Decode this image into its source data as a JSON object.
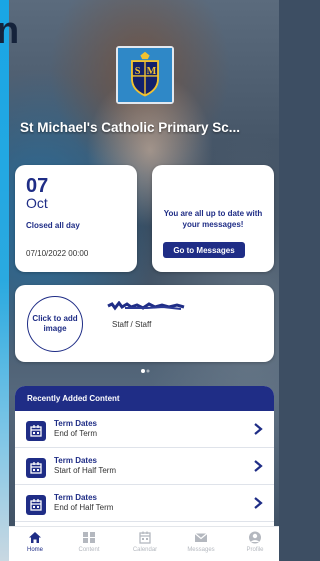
{
  "top_fragment": "n",
  "school": {
    "name": "St Michael's Catholic Primary Sc..."
  },
  "date_card": {
    "day": "07",
    "month": "Oct",
    "status": "Closed all day",
    "datetime": "07/10/2022 00:00"
  },
  "messages_card": {
    "text": "You are all up to date with your messages!",
    "button_label": "Go to Messages"
  },
  "profile": {
    "avatar_label": "Click to add image",
    "role": "Staff / Staff"
  },
  "content": {
    "header": "Recently Added Content",
    "items": [
      {
        "title": "Term Dates",
        "subtitle": "End of Term"
      },
      {
        "title": "Term Dates",
        "subtitle": "Start of Half Term"
      },
      {
        "title": "Term Dates",
        "subtitle": "End of Half Term"
      }
    ]
  },
  "tabs": [
    {
      "label": "Home",
      "icon": "home-icon",
      "active": true
    },
    {
      "label": "Content",
      "icon": "grid-icon",
      "active": false
    },
    {
      "label": "Calendar",
      "icon": "calendar-icon",
      "active": false
    },
    {
      "label": "Messages",
      "icon": "envelope-icon",
      "active": false
    },
    {
      "label": "Profile",
      "icon": "user-icon",
      "active": false
    }
  ],
  "colors": {
    "brand_navy": "#1f2d86",
    "crest_blue": "#2f88c7",
    "crest_gold": "#f2c230",
    "inactive_tab": "#b4b8bf"
  }
}
